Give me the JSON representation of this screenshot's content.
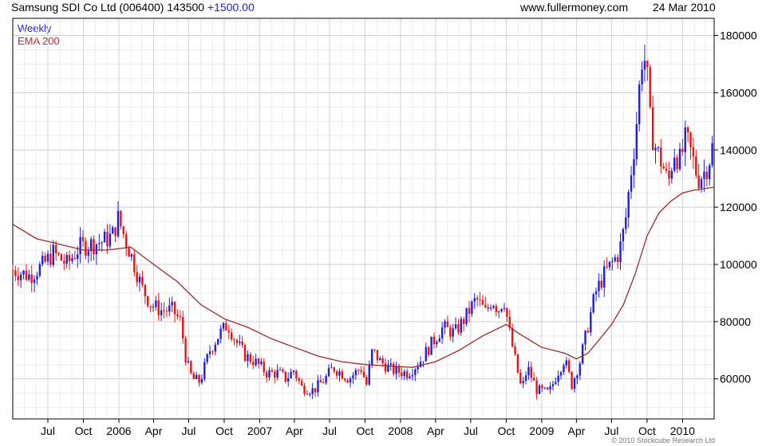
{
  "header": {
    "name": "Samsung SDI Co Ltd (006400)",
    "price": "143500",
    "change": "+1500.00",
    "site": "www.fullermoney.com",
    "date": "24 Mar 2010"
  },
  "legend": {
    "series1": "Weekly",
    "series2": "EMA 200"
  },
  "copyright": "© 2010 Stockcube Research Ltd",
  "colors": {
    "up": "#1e1ee0",
    "down": "#ee1111",
    "ema": "#a02828",
    "grid": "#dddddd",
    "frame": "#000000"
  },
  "chart_data": {
    "type": "candlestick",
    "series_name": "Weekly",
    "overlay_name": "EMA 200",
    "x_ticks": [
      "Jul",
      "Oct",
      "2006",
      "Apr",
      "Jul",
      "Oct",
      "2007",
      "Apr",
      "Jul",
      "Oct",
      "2008",
      "Apr",
      "Jul",
      "Oct",
      "2009",
      "Apr",
      "Jul",
      "Oct",
      "2010"
    ],
    "x_tick_dates": [
      "2005-07-01",
      "2005-10-01",
      "2006-01-01",
      "2006-04-01",
      "2006-07-01",
      "2006-10-01",
      "2007-01-01",
      "2007-04-01",
      "2007-07-01",
      "2007-10-01",
      "2008-01-01",
      "2008-04-01",
      "2008-07-01",
      "2008-10-01",
      "2009-01-01",
      "2009-04-01",
      "2009-07-01",
      "2009-10-01",
      "2010-01-01"
    ],
    "x_range": [
      "2005-04-01",
      "2010-03-24"
    ],
    "y_ticks": [
      60000,
      80000,
      100000,
      120000,
      140000,
      160000,
      180000
    ],
    "y_range": [
      46000,
      186000
    ],
    "y_axis_side": "right",
    "grid": true,
    "legend_position": "top-left",
    "close_path": [
      [
        "2005-04-01",
        98000
      ],
      [
        "2005-05-15",
        96000
      ],
      [
        "2005-06-20",
        100000
      ],
      [
        "2005-07-15",
        104000
      ],
      [
        "2005-08-20",
        100000
      ],
      [
        "2005-09-20",
        106000
      ],
      [
        "2005-10-20",
        107000
      ],
      [
        "2005-11-20",
        108000
      ],
      [
        "2005-12-15",
        110000
      ],
      [
        "2005-12-30",
        116000
      ],
      [
        "2006-01-20",
        108000
      ],
      [
        "2006-02-10",
        100000
      ],
      [
        "2006-03-01",
        92000
      ],
      [
        "2006-03-25",
        86000
      ],
      [
        "2006-04-20",
        84000
      ],
      [
        "2006-05-20",
        84000
      ],
      [
        "2006-06-10",
        80000
      ],
      [
        "2006-06-25",
        66000
      ],
      [
        "2006-07-10",
        60000
      ],
      [
        "2006-07-30",
        59000
      ],
      [
        "2006-08-25",
        70000
      ],
      [
        "2006-09-20",
        76000
      ],
      [
        "2006-10-10",
        79000
      ],
      [
        "2006-11-01",
        73000
      ],
      [
        "2006-11-25",
        68000
      ],
      [
        "2006-12-20",
        66000
      ],
      [
        "2007-01-20",
        62000
      ],
      [
        "2007-02-20",
        62000
      ],
      [
        "2007-03-10",
        60000
      ],
      [
        "2007-03-30",
        63000
      ],
      [
        "2007-04-20",
        57000
      ],
      [
        "2007-05-20",
        56000
      ],
      [
        "2007-06-20",
        60000
      ],
      [
        "2007-07-10",
        64000
      ],
      [
        "2007-08-01",
        62000
      ],
      [
        "2007-08-20",
        60000
      ],
      [
        "2007-09-20",
        64000
      ],
      [
        "2007-10-05",
        58000
      ],
      [
        "2007-10-20",
        70000
      ],
      [
        "2007-11-10",
        66000
      ],
      [
        "2007-12-10",
        63000
      ],
      [
        "2008-01-20",
        62000
      ],
      [
        "2008-02-20",
        66000
      ],
      [
        "2008-03-20",
        72000
      ],
      [
        "2008-04-20",
        78000
      ],
      [
        "2008-05-20",
        76000
      ],
      [
        "2008-06-15",
        81000
      ],
      [
        "2008-07-15",
        88000
      ],
      [
        "2008-08-10",
        83000
      ],
      [
        "2008-08-25",
        88000
      ],
      [
        "2008-09-10",
        84000
      ],
      [
        "2008-09-25",
        88000
      ],
      [
        "2008-10-10",
        76000
      ],
      [
        "2008-10-25",
        66000
      ],
      [
        "2008-11-10",
        56000
      ],
      [
        "2008-11-25",
        64000
      ],
      [
        "2008-12-20",
        56000
      ],
      [
        "2009-01-20",
        55000
      ],
      [
        "2009-02-10",
        62000
      ],
      [
        "2009-03-01",
        67000
      ],
      [
        "2009-03-20",
        58000
      ],
      [
        "2009-04-10",
        66000
      ],
      [
        "2009-04-30",
        78000
      ],
      [
        "2009-05-20",
        90000
      ],
      [
        "2009-06-10",
        96000
      ],
      [
        "2009-06-30",
        100000
      ],
      [
        "2009-07-20",
        104000
      ],
      [
        "2009-08-05",
        114000
      ],
      [
        "2009-08-20",
        132000
      ],
      [
        "2009-09-01",
        145000
      ],
      [
        "2009-09-10",
        160000
      ],
      [
        "2009-09-20",
        175000
      ],
      [
        "2009-09-30",
        168000
      ],
      [
        "2009-10-10",
        148000
      ],
      [
        "2009-10-25",
        140000
      ],
      [
        "2009-11-10",
        135000
      ],
      [
        "2009-11-25",
        128000
      ],
      [
        "2009-12-10",
        140000
      ],
      [
        "2009-12-25",
        136000
      ],
      [
        "2010-01-10",
        144000
      ],
      [
        "2010-01-25",
        138000
      ],
      [
        "2010-02-10",
        130000
      ],
      [
        "2010-02-25",
        132000
      ],
      [
        "2010-03-10",
        136000
      ],
      [
        "2010-03-24",
        143500
      ]
    ],
    "ema_200": [
      [
        "2005-04-01",
        114000
      ],
      [
        "2005-06-01",
        109000
      ],
      [
        "2005-08-01",
        107000
      ],
      [
        "2005-10-01",
        105000
      ],
      [
        "2005-12-01",
        105000
      ],
      [
        "2006-02-01",
        106000
      ],
      [
        "2006-04-01",
        100000
      ],
      [
        "2006-06-01",
        94000
      ],
      [
        "2006-08-01",
        86000
      ],
      [
        "2006-10-01",
        81000
      ],
      [
        "2006-12-01",
        78000
      ],
      [
        "2007-02-01",
        74000
      ],
      [
        "2007-04-01",
        71000
      ],
      [
        "2007-06-01",
        68000
      ],
      [
        "2007-08-01",
        66000
      ],
      [
        "2007-10-01",
        65000
      ],
      [
        "2007-12-01",
        64500
      ],
      [
        "2008-02-01",
        64000
      ],
      [
        "2008-04-01",
        66000
      ],
      [
        "2008-06-01",
        70000
      ],
      [
        "2008-08-01",
        75000
      ],
      [
        "2008-10-01",
        79000
      ],
      [
        "2008-11-01",
        76000
      ],
      [
        "2009-01-01",
        71000
      ],
      [
        "2009-03-01",
        69000
      ],
      [
        "2009-04-01",
        67000
      ],
      [
        "2009-05-01",
        69000
      ],
      [
        "2009-06-01",
        74000
      ],
      [
        "2009-07-01",
        79000
      ],
      [
        "2009-08-01",
        86000
      ],
      [
        "2009-09-01",
        97000
      ],
      [
        "2009-10-01",
        110000
      ],
      [
        "2009-11-01",
        118000
      ],
      [
        "2009-12-01",
        122000
      ],
      [
        "2010-01-01",
        125000
      ],
      [
        "2010-02-01",
        126000
      ],
      [
        "2010-03-24",
        127000
      ]
    ]
  }
}
